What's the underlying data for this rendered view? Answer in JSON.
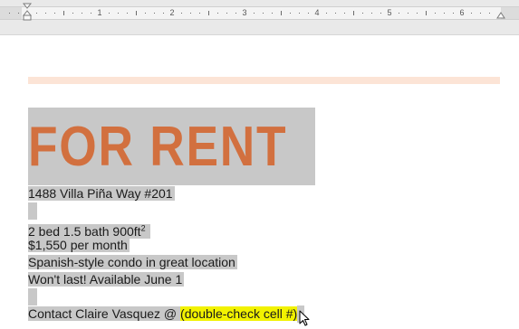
{
  "ruler": {
    "numbers": [
      "1",
      "2",
      "3",
      "4",
      "5",
      "6"
    ]
  },
  "document": {
    "heading": "FOR RENT",
    "address": "1488 Villa Piña Way #201",
    "specs_main": "2 bed 1.5 bath 900ft",
    "specs_sup": "2",
    "price": "$1,550 per month",
    "description": "Spanish-style condo in great location",
    "availability": "Won't last! Available June 1",
    "contact_prefix": "Contact Claire Vasquez @ ",
    "contact_highlight": "(double-check cell #)"
  },
  "colors": {
    "heading": "#d2703f",
    "selection": "#c8c8c8",
    "highlight": "#f2f200",
    "accent_band": "#fce4d6"
  }
}
